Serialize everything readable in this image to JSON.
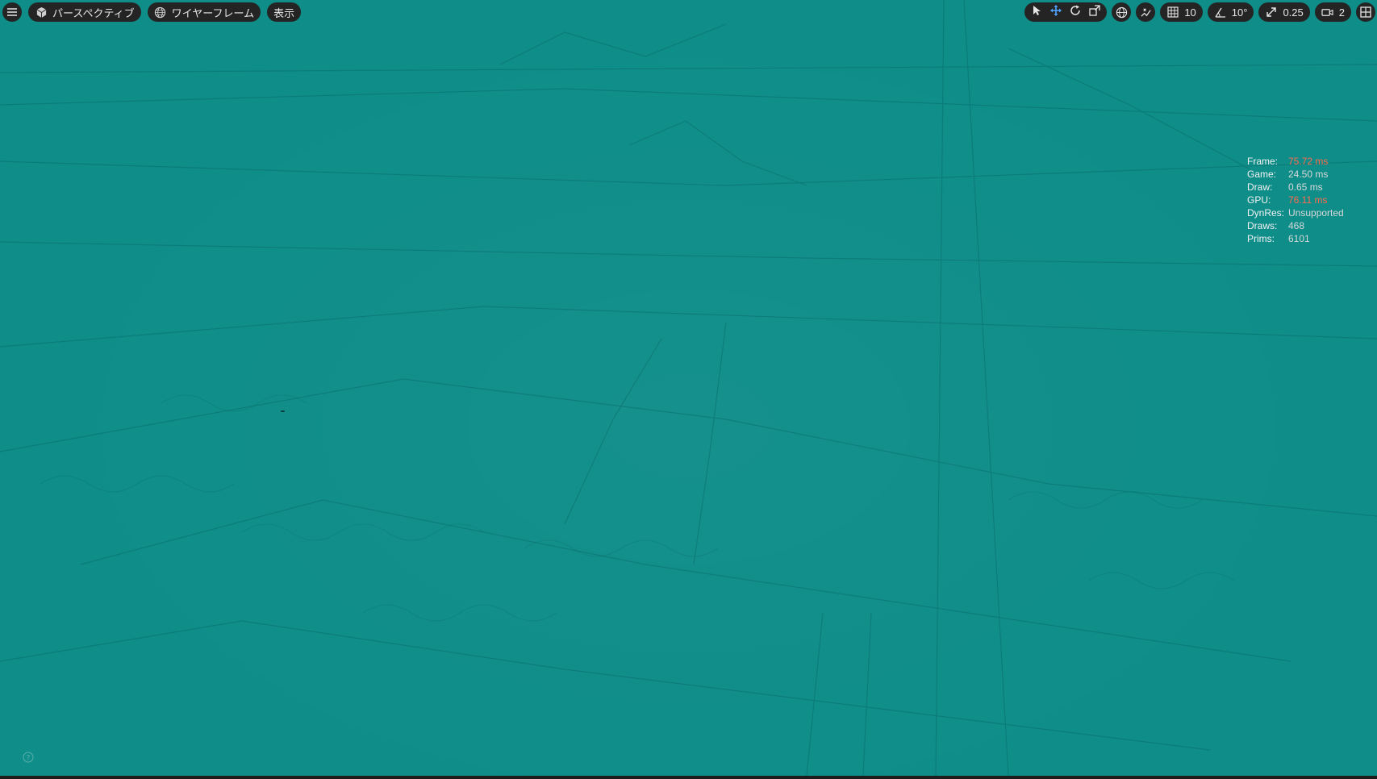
{
  "toolbar": {
    "menu_icon": "hamburger-menu-icon",
    "perspective_label": "パースペクティブ",
    "wireframe_label": "ワイヤーフレーム",
    "show_label": "表示",
    "grid_snap_value": "10",
    "rotation_snap_value": "10°",
    "scale_snap_value": "0.25",
    "camera_speed_value": "2"
  },
  "stats": [
    {
      "key": "Frame:",
      "value": "75.72 ms",
      "warn": true
    },
    {
      "key": "Game:",
      "value": "24.50 ms",
      "warn": false
    },
    {
      "key": "Draw:",
      "value": "0.65 ms",
      "warn": false
    },
    {
      "key": "GPU:",
      "value": "76.11 ms",
      "warn": true
    },
    {
      "key": "DynRes:",
      "value": "Unsupported",
      "warn": false
    },
    {
      "key": "Draws:",
      "value": "468",
      "warn": false
    },
    {
      "key": "Prims:",
      "value": "6101",
      "warn": false
    }
  ],
  "colors": {
    "viewport_bg": "#0e8d89",
    "toolbar_bg": "#242424",
    "accent_active": "#4ea4ff",
    "warn_text": "#ff6a4d"
  }
}
